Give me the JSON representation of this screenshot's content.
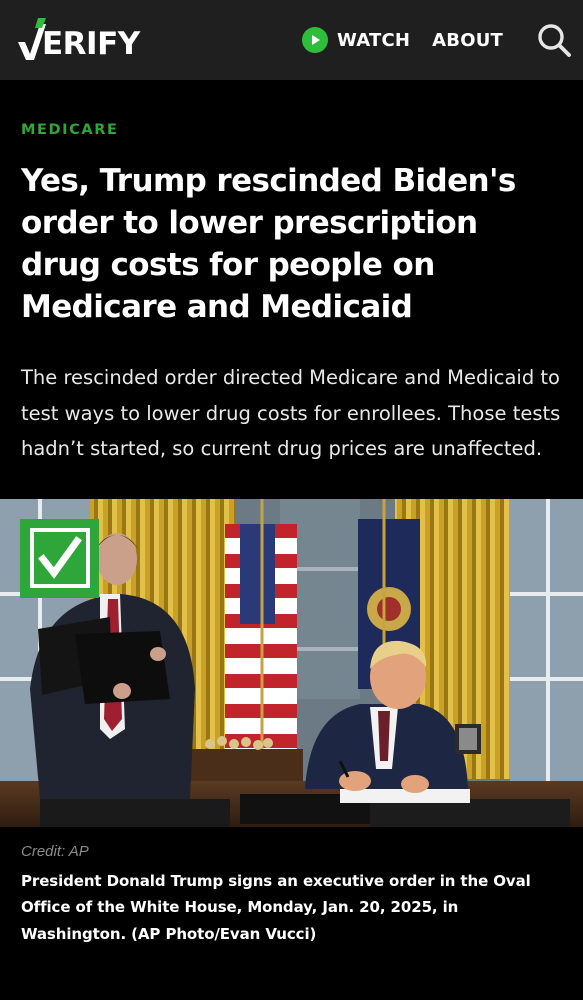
{
  "header": {
    "logo_text": "ERIFY",
    "logo_full": "VERIFY",
    "watch_label": "WATCH",
    "about_label": "ABOUT",
    "icons": {
      "watch": "play-icon",
      "search": "search-icon"
    },
    "colors": {
      "background": "#1f1f1f",
      "accent": "#2ebd3a"
    }
  },
  "article": {
    "category": "MEDICARE",
    "headline": "Yes, Trump rescinded Biden's order to lower prescription drug costs for people on Medicare and Medicaid",
    "summary": "The rescinded order directed Medicare and Medicaid to test ways to lower drug costs for enrollees. Those tests hadn’t started, so current drug prices are unaffected.",
    "category_color": "#2ea63a"
  },
  "photo": {
    "badge_icon": "verified-check-icon",
    "badge_color": "#2ea63a",
    "credit": "Credit: AP",
    "caption": "President Donald Trump signs an executive order in the Oval Office of the White House, Monday, Jan. 20, 2025, in Washington. (AP Photo/Evan Vucci)"
  }
}
